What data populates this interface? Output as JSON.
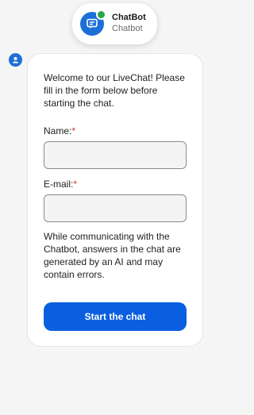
{
  "header": {
    "name": "ChatBot",
    "subtitle": "Chatbot",
    "avatar_icon": "chat-bubble-icon",
    "status": "online"
  },
  "colors": {
    "accent": "#0a5fe0",
    "online": "#28a745",
    "required": "#d0342c"
  },
  "form": {
    "welcome": "Welcome to our LiveChat! Please fill in the form below before starting the chat.",
    "name_label": "Name:",
    "name_value": "",
    "email_label": "E-mail:",
    "email_value": "",
    "required_marker": "*",
    "disclaimer": "While communicating with the Chatbot, answers in the chat are generated by an AI and may contain errors.",
    "submit_label": "Start the chat"
  }
}
